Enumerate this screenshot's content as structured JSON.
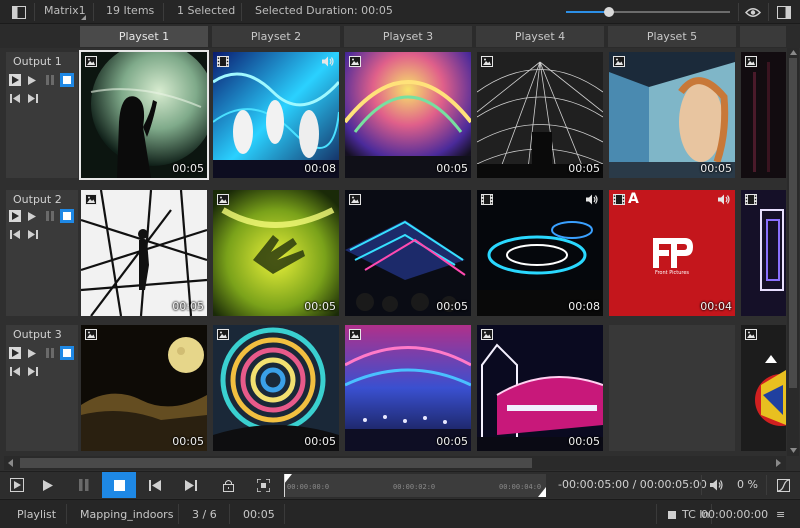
{
  "topbar": {
    "window_menu": "Matrix1",
    "items_count": "19 Items",
    "selected_count": "1 Selected",
    "selected_duration": "Selected Duration: 00:05",
    "zoom_level": 0.26
  },
  "playsets": [
    "Playset 1",
    "Playset 2",
    "Playset 3",
    "Playset 4",
    "Playset 5"
  ],
  "outputs": [
    {
      "name": "Output 1"
    },
    {
      "name": "Output 2"
    },
    {
      "name": "Output 3"
    }
  ],
  "cells": {
    "r1": [
      {
        "kind": "image",
        "duration": "00:05",
        "audio": false,
        "alpha": false
      },
      {
        "kind": "video",
        "duration": "00:08",
        "audio": true,
        "alpha": false
      },
      {
        "kind": "image",
        "duration": "00:05",
        "audio": false,
        "alpha": false
      },
      {
        "kind": "image",
        "duration": "00:05",
        "audio": false,
        "alpha": false
      },
      {
        "kind": "image",
        "duration": "00:05",
        "audio": false,
        "alpha": false
      }
    ],
    "r2": [
      {
        "kind": "image",
        "duration": "00:05",
        "audio": false,
        "alpha": false
      },
      {
        "kind": "image",
        "duration": "00:05",
        "audio": false,
        "alpha": false
      },
      {
        "kind": "image",
        "duration": "00:05",
        "audio": false,
        "alpha": false
      },
      {
        "kind": "video",
        "duration": "00:08",
        "audio": true,
        "alpha": false
      },
      {
        "kind": "video",
        "duration": "00:04",
        "audio": true,
        "alpha": true,
        "alpha_label": "A",
        "brand_text": "Front Pictures"
      }
    ],
    "r3": [
      {
        "kind": "image",
        "duration": "00:05",
        "audio": false,
        "alpha": false
      },
      {
        "kind": "image",
        "duration": "00:05",
        "audio": false,
        "alpha": false
      },
      {
        "kind": "image",
        "duration": "00:05",
        "audio": false,
        "alpha": false
      },
      {
        "kind": "image",
        "duration": "00:05",
        "audio": false,
        "alpha": false
      }
    ]
  },
  "timeline": {
    "ticks": [
      "00:00:00:0",
      "00:00:02:0",
      "00:00:04:0"
    ],
    "time_display": "-00:00:05:00 / 00:00:05:00",
    "volume": "0 %"
  },
  "statusbar": {
    "mode": "Playlist",
    "project": "Mapping_indoors",
    "position": "3 / 6",
    "duration": "00:05",
    "tc_label": "TC In",
    "tc_value": "00:00:00:00"
  },
  "colors": {
    "accent": "#1e88e5",
    "background": "#2f2f2f",
    "panel": "#3a3a3a"
  }
}
